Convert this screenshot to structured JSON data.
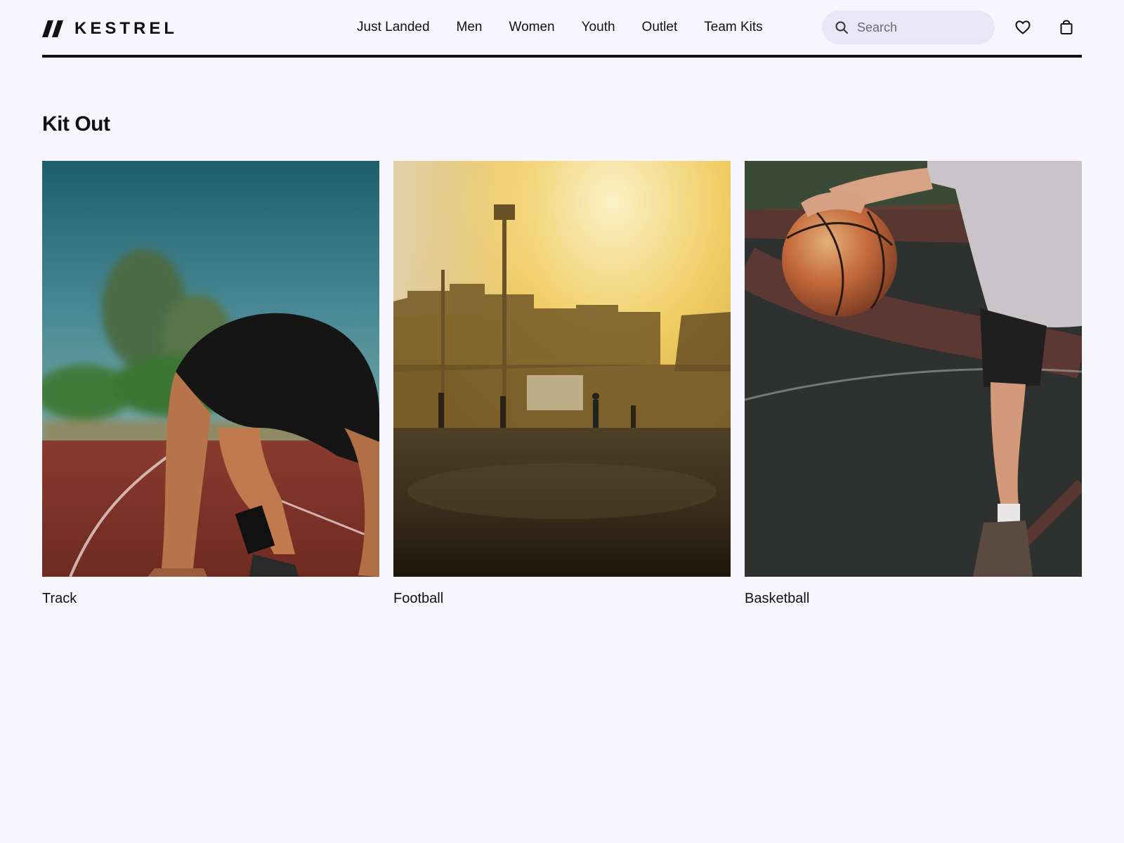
{
  "brand": {
    "name": "KESTREL",
    "logo_icon": "double-slash-logo-icon"
  },
  "nav": {
    "items": [
      {
        "label": "Just Landed"
      },
      {
        "label": "Men"
      },
      {
        "label": "Women"
      },
      {
        "label": "Youth"
      },
      {
        "label": "Outlet"
      },
      {
        "label": "Team Kits"
      }
    ]
  },
  "search": {
    "placeholder": "Search",
    "value": "",
    "icon": "search-icon"
  },
  "actions": {
    "favorites_icon": "heart-icon",
    "bag_icon": "shopping-bag-icon"
  },
  "section": {
    "title": "Kit Out",
    "cards": [
      {
        "label": "Track",
        "image": "sprinter-on-running-track-photo"
      },
      {
        "label": "Football",
        "image": "football-field-at-sunset-photo"
      },
      {
        "label": "Basketball",
        "image": "player-holding-basketball-photo"
      }
    ]
  },
  "colors": {
    "background": "#f8f6fd",
    "text": "#111111",
    "search_bg": "#e9e6f5"
  }
}
